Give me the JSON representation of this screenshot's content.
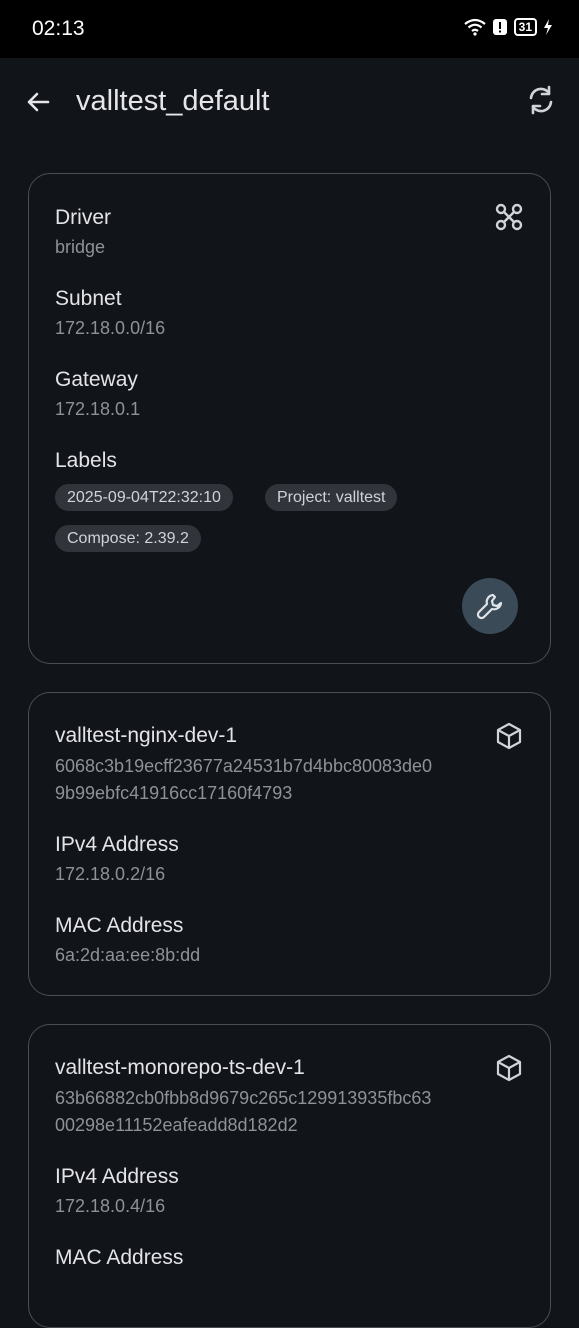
{
  "status_bar": {
    "time": "02:13",
    "battery": "31"
  },
  "app_bar": {
    "title": "valltest_default"
  },
  "network": {
    "driver_label": "Driver",
    "driver_value": "bridge",
    "subnet_label": "Subnet",
    "subnet_value": "172.18.0.0/16",
    "gateway_label": "Gateway",
    "gateway_value": "172.18.0.1",
    "labels_label": "Labels",
    "labels": [
      "2025-09-04T22:32:10",
      "Project: valltest",
      "Compose: 2.39.2"
    ]
  },
  "containers": [
    {
      "name": "valltest-nginx-dev-1",
      "id_line1": "6068c3b19ecff23677a24531b7d4bbc80083de0",
      "id_line2": "9b99ebfc41916cc17160f4793",
      "ipv4_label": "IPv4 Address",
      "ipv4_value": "172.18.0.2/16",
      "mac_label": "MAC Address",
      "mac_value": "6a:2d:aa:ee:8b:dd"
    },
    {
      "name": "valltest-monorepo-ts-dev-1",
      "id_line1": "63b66882cb0fbb8d9679c265c129913935fbc63",
      "id_line2": "00298e11152eafeadd8d182d2",
      "ipv4_label": "IPv4 Address",
      "ipv4_value": "172.18.0.4/16",
      "mac_label": "MAC Address"
    }
  ]
}
